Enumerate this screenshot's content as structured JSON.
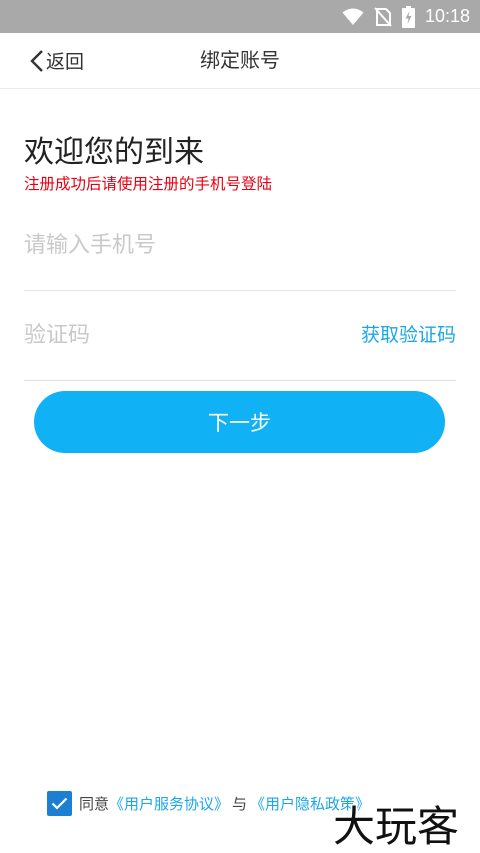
{
  "status_bar": {
    "time": "10:18",
    "icons": [
      "wifi-icon",
      "no-sim-icon",
      "battery-charging-icon"
    ]
  },
  "nav": {
    "back_label": "返回",
    "title": "绑定账号"
  },
  "welcome": {
    "title": "欢迎您的到来",
    "hint": "注册成功后请使用注册的手机号登陆"
  },
  "form": {
    "phone_placeholder": "请输入手机号",
    "phone_value": "",
    "code_placeholder": "验证码",
    "code_value": "",
    "get_code_label": "获取验证码"
  },
  "next_button": "下一步",
  "agreement": {
    "checked": true,
    "prefix": "同意",
    "service_link": "《用户服务协议》",
    "middle": "与",
    "privacy_link": "《用户隐私政策》"
  },
  "watermark": "大玩客",
  "colors": {
    "accent": "#10b2f5",
    "link": "#1aa7e8",
    "hint": "#e60012",
    "checkbox": "#1c7fd1",
    "status_bar": "#a9a9a9"
  }
}
